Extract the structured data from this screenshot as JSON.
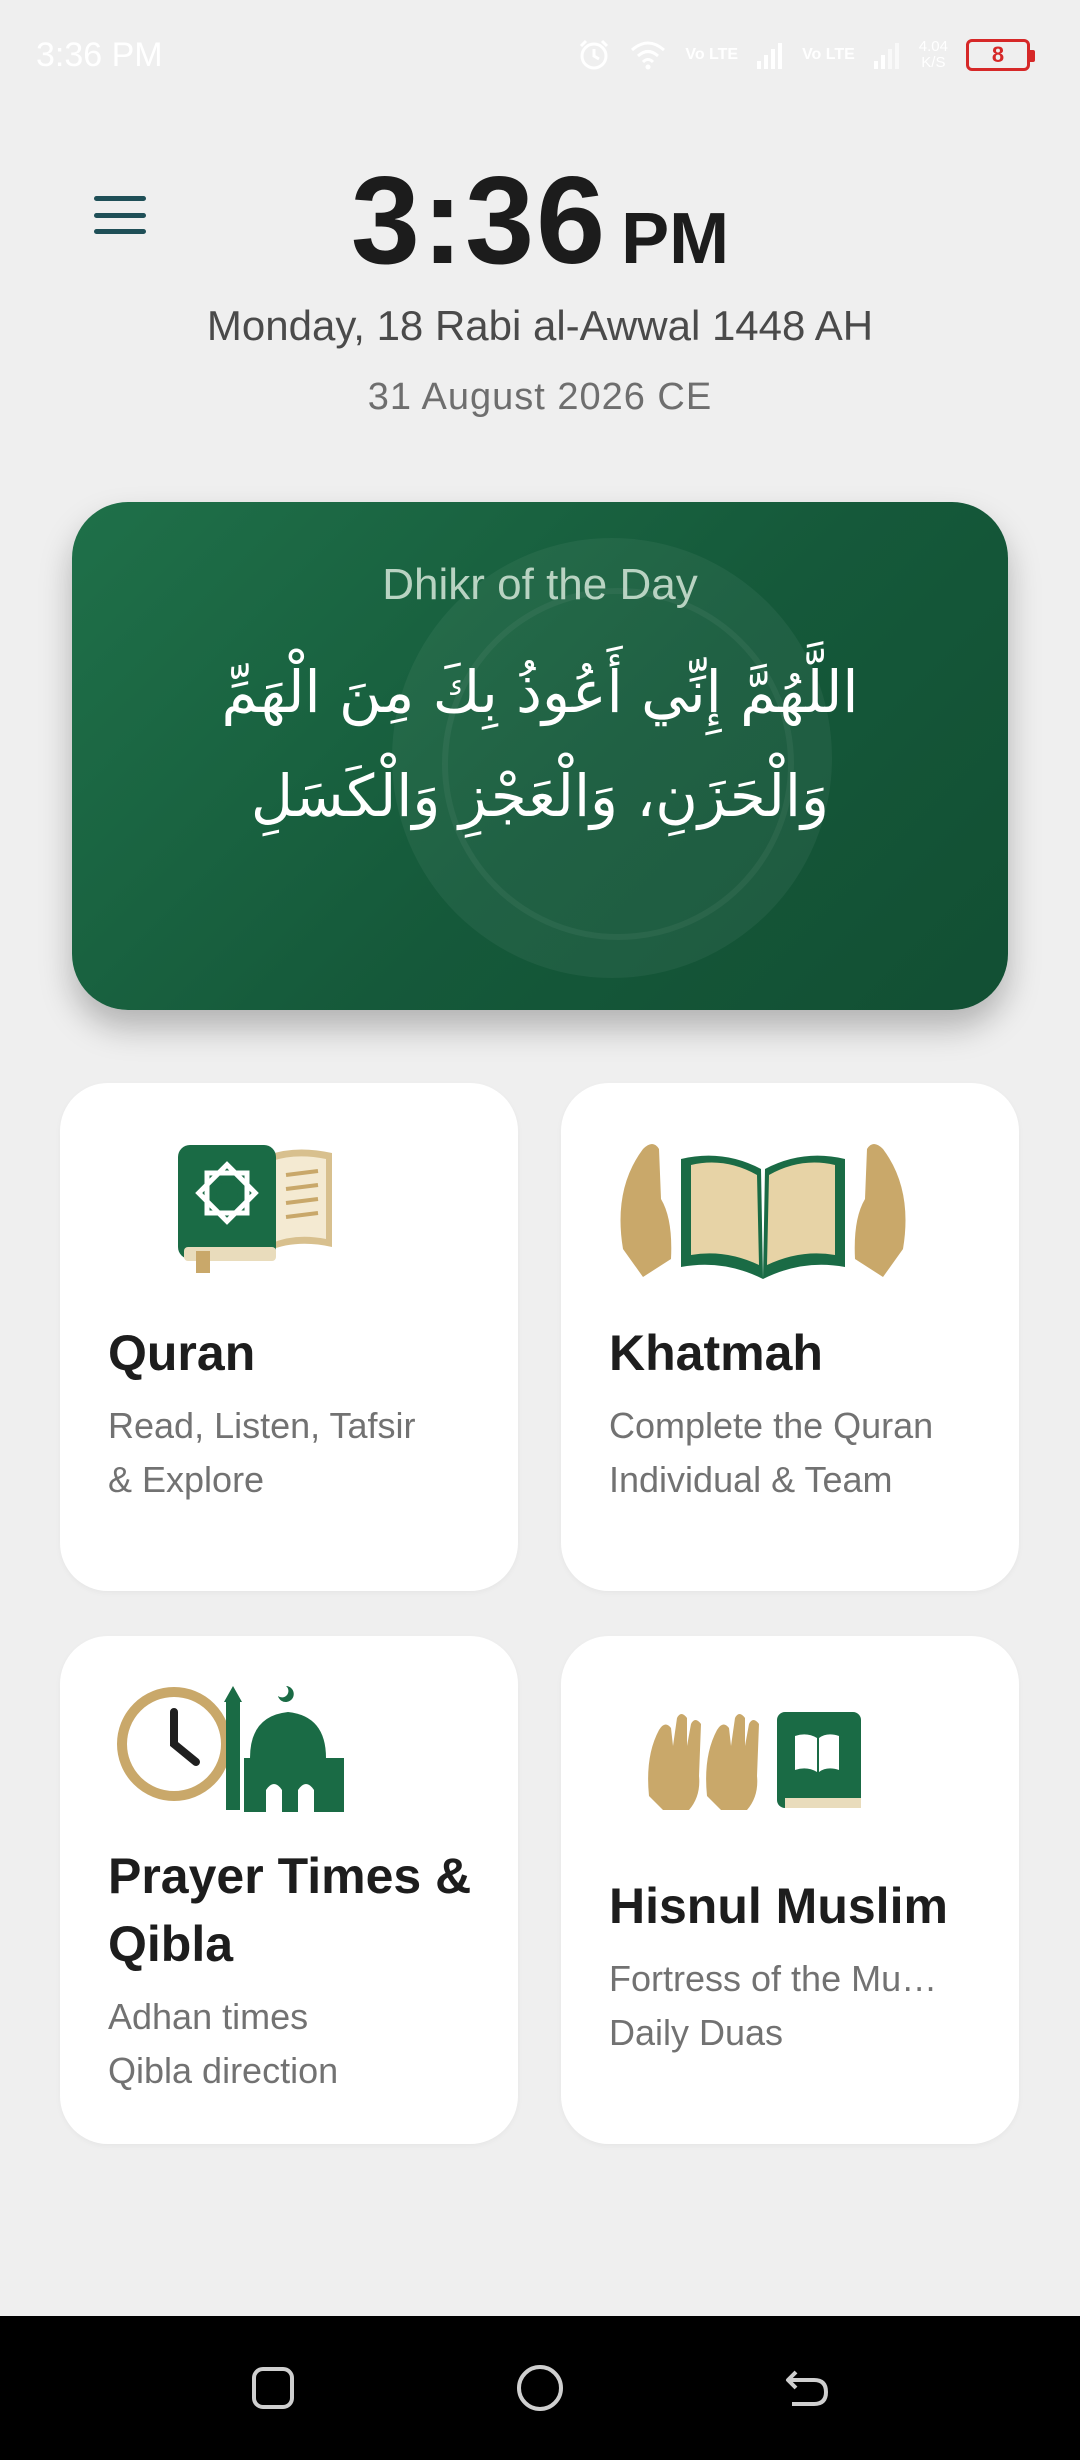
{
  "status_bar": {
    "time": "3:36 PM",
    "network_speed_value": "4.04",
    "network_speed_unit": "K/S",
    "sim1_label": "Vo LTE",
    "sim2_label": "Vo LTE",
    "battery_level": "8",
    "icons": [
      "alarm-icon",
      "wifi-icon",
      "signal-icon",
      "signal-icon",
      "battery-icon"
    ]
  },
  "header": {
    "time": "3:36",
    "ampm": "PM",
    "hijri_date": "Monday, 18 Rabi al-Awwal 1448 AH",
    "gregorian_date": "31 August 2026 CE"
  },
  "dhikr": {
    "title": "Dhikr of the Day",
    "text": "اللَّهُمَّ إِنِّي أَعُوذُ بِكَ مِنَ الْهَمِّ وَالْحَزَنِ، وَالْعَجْزِ وَالْكَسَلِ"
  },
  "cards": {
    "quran": {
      "title": "Quran",
      "subtitle_line1": "Read, Listen, Tafsir",
      "subtitle_line2": "& Explore",
      "icon": "quran-book-icon"
    },
    "khatmah": {
      "title": "Khatmah",
      "subtitle_line1": "Complete the Quran",
      "subtitle_line2": "Individual & Team",
      "icon": "open-quran-hands-icon"
    },
    "prayer": {
      "title_line1": "Prayer Times &",
      "title_line2": "Qibla",
      "subtitle_line1": "Adhan times",
      "subtitle_line2": "Qibla direction",
      "icon": "clock-mosque-icon"
    },
    "hisnul": {
      "title": "Hisnul Muslim",
      "subtitle_line1": "Fortress of the Mu…",
      "subtitle_line2": "Daily Duas",
      "icon": "praying-hands-book-icon"
    }
  },
  "colors": {
    "primary_green": "#1a6b45",
    "gold": "#c9a86a",
    "background": "#efefef"
  },
  "nav_bar": {
    "buttons": [
      "recents-square-icon",
      "home-circle-icon",
      "back-arrow-icon"
    ]
  }
}
